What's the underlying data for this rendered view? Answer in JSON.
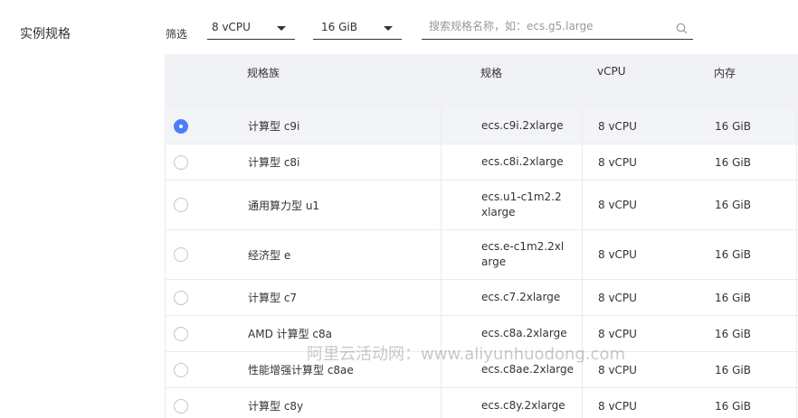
{
  "section_label": "实例规格",
  "filter_label": "筛选",
  "filters": {
    "vcpu": "8 vCPU",
    "memory": "16 GiB",
    "search_placeholder": "搜索规格名称，如：ecs.g5.large"
  },
  "table": {
    "headers": {
      "family": "规格族",
      "spec": "规格",
      "vcpu": "vCPU",
      "memory": "内存"
    },
    "rows": [
      {
        "family": "计算型 c9i",
        "spec": "ecs.c9i.2xlarge",
        "vcpu": "8 vCPU",
        "memory": "16 GiB",
        "selected": true
      },
      {
        "family": "计算型 c8i",
        "spec": "ecs.c8i.2xlarge",
        "vcpu": "8 vCPU",
        "memory": "16 GiB",
        "selected": false
      },
      {
        "family": "通用算力型 u1",
        "spec": "ecs.u1-c1m2.2xlarge",
        "vcpu": "8 vCPU",
        "memory": "16 GiB",
        "selected": false
      },
      {
        "family": "经济型 e",
        "spec": "ecs.e-c1m2.2xlarge",
        "vcpu": "8 vCPU",
        "memory": "16 GiB",
        "selected": false
      },
      {
        "family": "计算型 c7",
        "spec": "ecs.c7.2xlarge",
        "vcpu": "8 vCPU",
        "memory": "16 GiB",
        "selected": false
      },
      {
        "family": "AMD 计算型 c8a",
        "spec": "ecs.c8a.2xlarge",
        "vcpu": "8 vCPU",
        "memory": "16 GiB",
        "selected": false
      },
      {
        "family": "性能增强计算型 c8ae",
        "spec": "ecs.c8ae.2xlarge",
        "vcpu": "8 vCPU",
        "memory": "16 GiB",
        "selected": false
      },
      {
        "family": "计算型 c8y",
        "spec": "ecs.c8y.2xlarge",
        "vcpu": "8 vCPU",
        "memory": "16 GiB",
        "selected": false
      }
    ]
  },
  "watermark": "阿里云活动网：www.aliyunhuodong.com",
  "colors": {
    "accent": "#4a7ff7",
    "header_bg": "#f1f2f6",
    "selected_row_bg": "#f3f4f8"
  }
}
